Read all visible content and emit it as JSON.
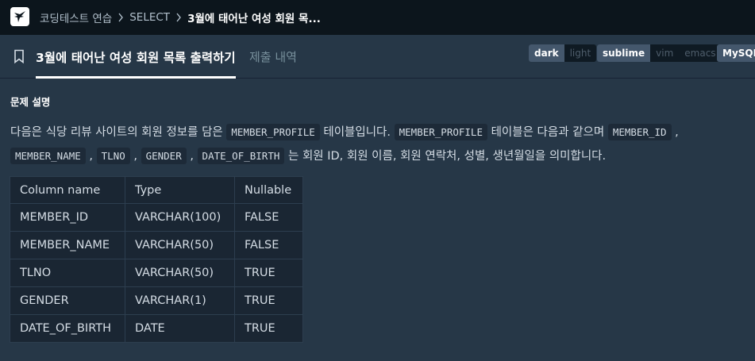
{
  "breadcrumb": {
    "items": [
      "코딩테스트 연습",
      "SELECT",
      "3월에 태어난 여성 회원 목..."
    ]
  },
  "tabs": {
    "problem": "3월에 태어난 여성 회원 목록 출력하기",
    "submissions": "제출 내역"
  },
  "toggles": {
    "theme": [
      "dark",
      "light"
    ],
    "editor": [
      "sublime",
      "vim",
      "emacs"
    ],
    "language": "MySQL"
  },
  "section_title": "문제 설명",
  "description": {
    "t1": "다음은 식당 리뷰 사이트의 회원 정보를 담은 ",
    "c1": "MEMBER_PROFILE",
    "t2": " 테이블입니다. ",
    "c2": "MEMBER_PROFILE",
    "t3": " 테이블은 다음과 같으며 ",
    "c3": "MEMBER_ID",
    "t4": " , ",
    "c4": "MEMBER_NAME",
    "t5": " , ",
    "c5": "TLNO",
    "t6": " , ",
    "c6": "GENDER",
    "t7": " , ",
    "c7": "DATE_OF_BIRTH",
    "t8": " 는 회원 ID, 회원 이름, 회원 연락처, 성별, 생년월일을 의미합니다."
  },
  "schema_table": {
    "headers": [
      "Column name",
      "Type",
      "Nullable"
    ],
    "rows": [
      [
        "MEMBER_ID",
        "VARCHAR(100)",
        "FALSE"
      ],
      [
        "MEMBER_NAME",
        "VARCHAR(50)",
        "FALSE"
      ],
      [
        "TLNO",
        "VARCHAR(50)",
        "TRUE"
      ],
      [
        "GENDER",
        "VARCHAR(1)",
        "TRUE"
      ],
      [
        "DATE_OF_BIRTH",
        "DATE",
        "TRUE"
      ]
    ]
  }
}
